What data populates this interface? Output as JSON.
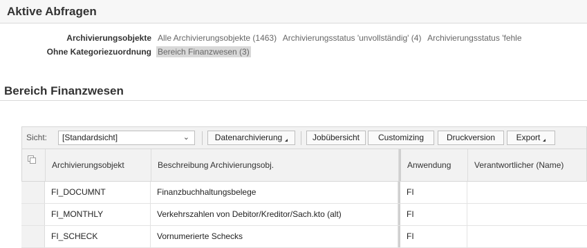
{
  "page": {
    "title": "Aktive Abfragen"
  },
  "queries": {
    "rows": [
      {
        "label": "Archivierungsobjekte",
        "links": [
          "Alle Archivierungsobjekte (1463)",
          "Archivierungsstatus 'unvollständig' (4)",
          "Archivierungsstatus 'fehle"
        ]
      },
      {
        "label": "Ohne Kategoriezuordnung",
        "links": [
          "Bereich Finanzwesen (3)"
        ]
      }
    ]
  },
  "section": {
    "title": "Bereich Finanzwesen"
  },
  "toolbar": {
    "view_label": "Sicht:",
    "view_value": "[Standardsicht]",
    "buttons": {
      "data_archiving": "Datenarchivierung",
      "job_overview": "Jobübersicht",
      "customizing": "Customizing",
      "print_version": "Druckversion",
      "export": "Export"
    }
  },
  "table": {
    "columns": [
      "Archivierungsobjekt",
      "Beschreibung Archivierungsobj.",
      "Anwendung",
      "Verantwortlicher (Name)"
    ],
    "rows": [
      {
        "object": "FI_DOCUMNT",
        "description": "Finanzbuchhaltungsbelege",
        "application": "FI",
        "responsible": ""
      },
      {
        "object": "FI_MONTHLY",
        "description": "Verkehrszahlen von Debitor/Kreditor/Sach.kto (alt)",
        "application": "FI",
        "responsible": ""
      },
      {
        "object": "FI_SCHECK",
        "description": "Vornumerierte Schecks",
        "application": "FI",
        "responsible": ""
      }
    ]
  },
  "colors": {
    "header_background": "#f7f7f7",
    "toolbar_background": "#f2f2f2",
    "selected_query_background": "#d8d8d8"
  }
}
